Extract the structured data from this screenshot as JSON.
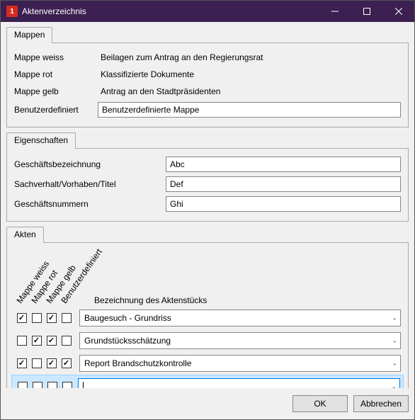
{
  "window": {
    "icon_text": "1",
    "title": "Aktenverzeichnis"
  },
  "mappen": {
    "tab": "Mappen",
    "rows": [
      {
        "label": "Mappe weiss",
        "value": "Beilagen zum Antrag an den Regierungsrat"
      },
      {
        "label": "Mappe rot",
        "value": "Klassifizierte Dokumente"
      },
      {
        "label": "Mappe gelb",
        "value": "Antrag an den Stadtpräsidenten"
      }
    ],
    "custom_label": "Benutzerdefiniert",
    "custom_value": "Benutzerdefinierte Mappe"
  },
  "eigenschaften": {
    "tab": "Eigenschaften",
    "rows": [
      {
        "label": "Geschäftsbezeichnung",
        "value": "Abc"
      },
      {
        "label": "Sachverhalt/Vorhaben/Titel",
        "value": "Def"
      },
      {
        "label": "Geschäftsnummern",
        "value": "Ghi"
      }
    ]
  },
  "akten": {
    "tab": "Akten",
    "headers": {
      "col0": "Mappe weiss",
      "col1": "Mappe rot",
      "col2": "Mappe gelb",
      "col3": "Benutzerdefiniert",
      "bezeichnung": "Bezeichnung des Aktenstücks"
    },
    "rows": [
      {
        "checks": [
          true,
          false,
          true,
          false
        ],
        "value": "Baugesuch - Grundriss"
      },
      {
        "checks": [
          false,
          true,
          true,
          false
        ],
        "value": "Grundstücksschätzung"
      },
      {
        "checks": [
          true,
          false,
          true,
          true
        ],
        "value": "Report Brandschutzkontrolle"
      },
      {
        "checks": [
          false,
          false,
          false,
          false
        ],
        "value": ""
      }
    ]
  },
  "footer": {
    "ok": "OK",
    "cancel": "Abbrechen"
  }
}
